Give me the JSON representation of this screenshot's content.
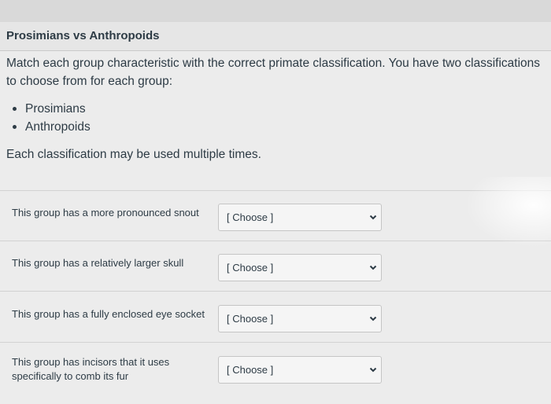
{
  "question": {
    "title": "Prosimians vs Anthropoids",
    "instructions": "Match each group characteristic with the correct primate classification. You have two classifications to choose from for each group:",
    "options": [
      "Prosimians",
      "Anthropoids"
    ],
    "note": "Each classification may be used multiple times."
  },
  "matches": [
    {
      "prompt": "This group has a more pronounced snout",
      "selected": "[ Choose ]"
    },
    {
      "prompt": "This group has a relatively larger skull",
      "selected": "[ Choose ]"
    },
    {
      "prompt": "This group has a fully enclosed eye socket",
      "selected": "[ Choose ]"
    },
    {
      "prompt": "This group has incisors that it uses specifically to comb its fur",
      "selected": "[ Choose ]"
    }
  ],
  "icons": {
    "dropdown": "chevron-down-icon",
    "bullet": "bullet-dot"
  },
  "colors": {
    "text": "#2d3b45",
    "background": "#ececec",
    "select_border": "#c5c5c5"
  }
}
